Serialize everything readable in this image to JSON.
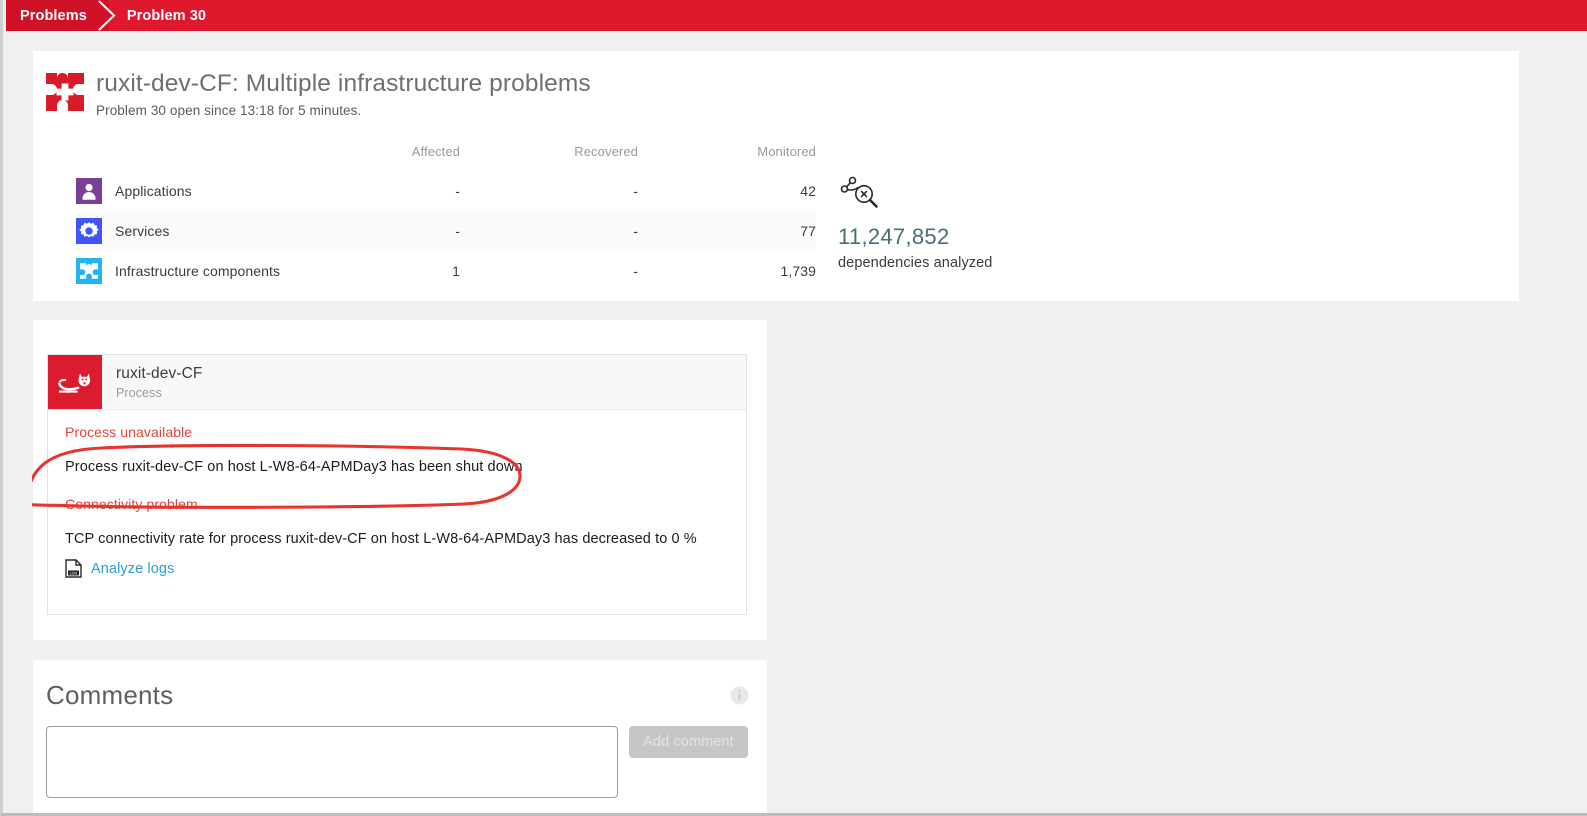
{
  "breadcrumb": {
    "root": "Problems",
    "current": "Problem 30",
    "separator_icon": "chevron-right-icon"
  },
  "summary": {
    "icon": "infrastructure-problem-icon",
    "title": "ruxit-dev-CF: Multiple infrastructure problems",
    "subtitle": "Problem 30 open since 13:18 for 5 minutes.",
    "columns": [
      "",
      "Affected",
      "Recovered",
      "Monitored"
    ],
    "rows": [
      {
        "icon": "applications-icon",
        "icon_color": "#7B3F98",
        "label": "Applications",
        "affected": "-",
        "recovered": "-",
        "monitored": "42",
        "affected_is_hit": false
      },
      {
        "icon": "services-gear-icon",
        "icon_color": "#4255F5",
        "label": "Services",
        "affected": "-",
        "recovered": "-",
        "monitored": "77",
        "affected_is_hit": false
      },
      {
        "icon": "infrastructure-components-icon",
        "icon_color": "#1FB6F0",
        "label": "Infrastructure components",
        "affected": "1",
        "recovered": "-",
        "monitored": "1,739",
        "affected_is_hit": true
      }
    ],
    "dependencies": {
      "icon": "dependency-analysis-icon",
      "count": "11,247,852",
      "label": "dependencies analyzed",
      "count_color": "#4a6d75"
    }
  },
  "event_card": {
    "entity": {
      "icon": "tomcat-process-icon",
      "icon_bg": "#dd1b2e",
      "name": "ruxit-dev-CF",
      "type": "Process"
    },
    "events": [
      {
        "title": "Process unavailable",
        "description": "Process ruxit-dev-CF on host L-W8-64-APMDay3 has been shut down",
        "highlighted": true
      },
      {
        "title": "Connectivity problem",
        "description": "TCP connectivity rate for process ruxit-dev-CF on host L-W8-64-APMDay3 has decreased to 0 %",
        "highlighted": false
      }
    ],
    "log_link": {
      "icon": "log-document-icon",
      "label": "Analyze logs",
      "color": "#2b9fd1"
    },
    "annotation_color": "#e8342f"
  },
  "comments": {
    "title": "Comments",
    "info_icon": "info-circle-icon",
    "input_value": "",
    "input_placeholder": "",
    "add_button_label": "Add comment"
  },
  "theme": {
    "brand_red": "#e0182d",
    "brand_red_dark": "#cf1227",
    "page_background": "#f0f0f0",
    "card_background": "#ffffff",
    "error_text": "#e2453c"
  }
}
